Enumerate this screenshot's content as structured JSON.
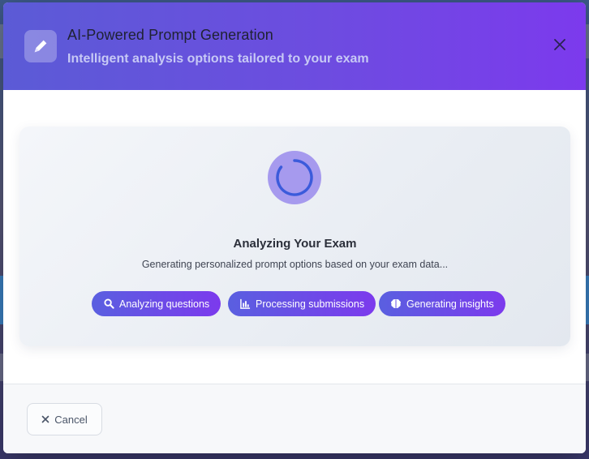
{
  "modal": {
    "title": "AI-Powered Prompt Generation",
    "subtitle": "Intelligent analysis options tailored to your exam",
    "header_icon": "pencil-icon",
    "close_icon": "close-icon"
  },
  "loading": {
    "title": "Analyzing Your Exam",
    "description": "Generating personalized prompt options based on your exam data...",
    "steps": [
      {
        "label": "Analyzing questions",
        "icon": "search-icon"
      },
      {
        "label": "Processing submissions",
        "icon": "bar-chart-icon"
      },
      {
        "label": "Generating insights",
        "icon": "brain-icon"
      }
    ]
  },
  "footer": {
    "cancel_label": "Cancel",
    "cancel_icon": "close-icon"
  },
  "colors": {
    "header_gradient_start": "#5b5bd6",
    "header_gradient_end": "#7c3aed",
    "spinner": "#3b5bdb",
    "chip_gradient_start": "#5a5fe0",
    "chip_gradient_end": "#7c3aed"
  }
}
